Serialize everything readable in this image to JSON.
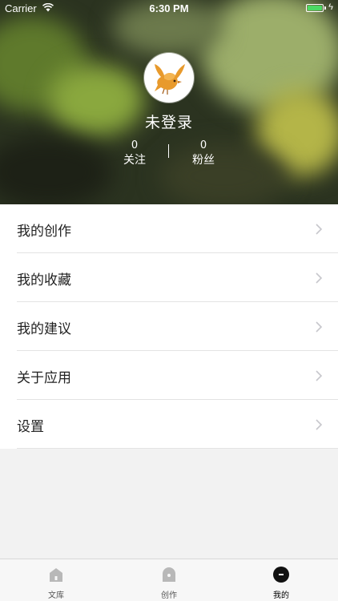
{
  "status_bar": {
    "carrier": "Carrier",
    "time": "6:30 PM"
  },
  "profile": {
    "username": "未登录",
    "following": {
      "count": "0",
      "label": "关注"
    },
    "followers": {
      "count": "0",
      "label": "粉丝"
    }
  },
  "menu": [
    {
      "label": "我的创作"
    },
    {
      "label": "我的收藏"
    },
    {
      "label": "我的建议"
    },
    {
      "label": "关于应用"
    },
    {
      "label": "设置"
    }
  ],
  "tabs": [
    {
      "label": "文库",
      "icon": "library-icon",
      "active": false
    },
    {
      "label": "创作",
      "icon": "create-icon",
      "active": false
    },
    {
      "label": "我的",
      "icon": "profile-icon",
      "active": true
    }
  ],
  "colors": {
    "battery": "#4cd964",
    "header_bg": "#2b3320"
  }
}
